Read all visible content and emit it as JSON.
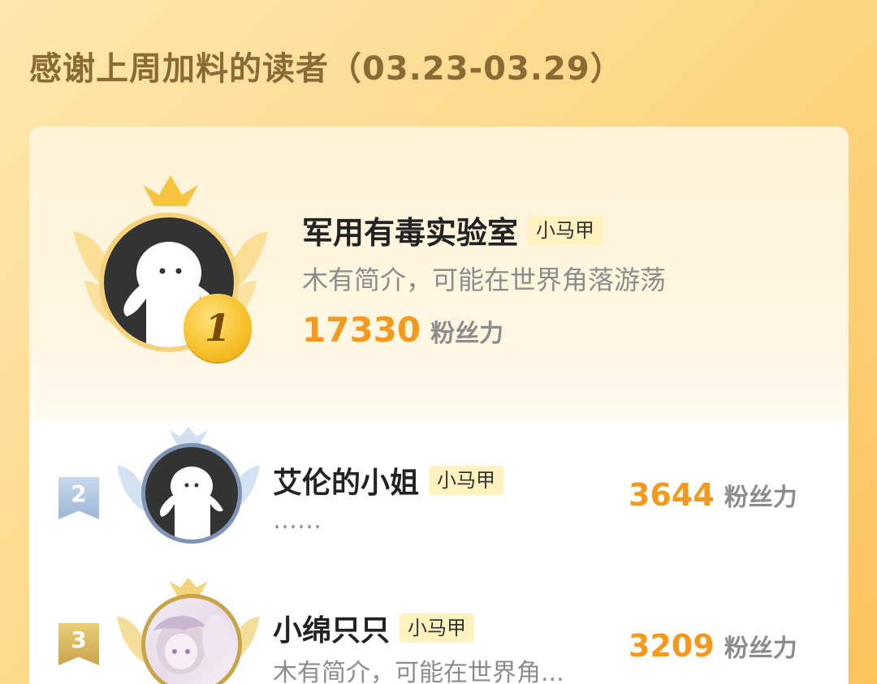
{
  "header": {
    "title": "感谢上周加料的读者（03.23-03.29）"
  },
  "ranking": [
    {
      "rank": "1",
      "name": "军用有毒实验室",
      "tag": "小马甲",
      "desc": "木有简介，可能在世界角落游荡",
      "fans_value": "17330",
      "fans_unit": "粉丝力",
      "avatar": "default-ghost-avatar"
    },
    {
      "rank": "2",
      "name": "艾伦的小姐",
      "tag": "小马甲",
      "desc": "……",
      "fans_value": "3644",
      "fans_unit": "粉丝力",
      "avatar": "default-ghost-avatar"
    },
    {
      "rank": "3",
      "name": "小绵只只",
      "tag": "小马甲",
      "desc": "木有简介，可能在世界角...",
      "fans_value": "3209",
      "fans_unit": "粉丝力",
      "avatar": "anime-girl-avatar"
    }
  ],
  "colors": {
    "accent": "#f39a1e",
    "background": "#fdd98a",
    "gold": "#f6d27a",
    "silver": "#7f95b3"
  }
}
